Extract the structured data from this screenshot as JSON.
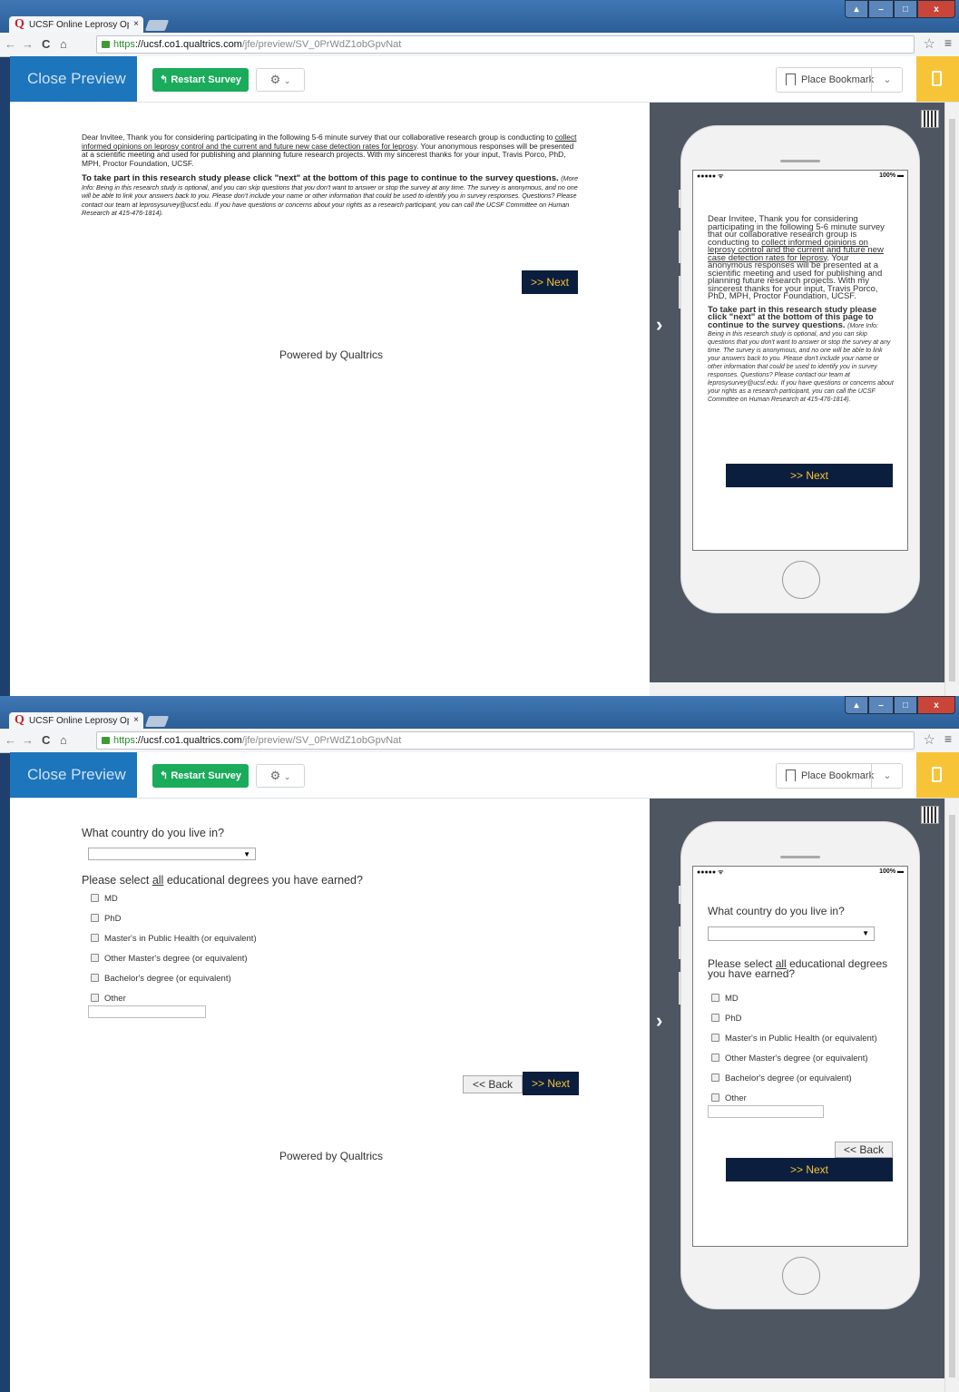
{
  "browser": {
    "tab_title": "UCSF Online Leprosy Opi",
    "tab_close": "×",
    "url_https": "https",
    "url_host": "://ucsf.co1.qualtrics.com",
    "url_path": "/jfe/preview/SV_0PrWdZ1obGpvNat"
  },
  "header": {
    "close_preview": "Close Preview",
    "restart_survey": "Restart Survey",
    "place_bookmark": "Place Bookmark"
  },
  "page1": {
    "intro_p1a": "Dear Invitee,  Thank you for considering participating in the following 5-6 minute survey that our collaborative research group is conducting to ",
    "intro_link": "collect informed opinions on leprosy control and the current and future new case detection rates for leprosy",
    "intro_p1b": ".  Your anonymous responses will be presented at a scientific meeting and used for publishing and planning future research projects.  With my sincerest thanks for your input, Travis Porco, PhD, MPH, Proctor Foundation, UCSF.",
    "intro_bold": "To take part in this research study please click \"next\" at the bottom of this page to continue to the survey questions",
    "intro_italic": "(More Info: Being in this research study is optional, and you can skip questions that you don't want to answer or stop the survey at any time.  The survey is anonymous, and no one will be able to link your answers back to you. Please don't include your name or other information that could be used to identify you in survey responses. Questions? Please contact our team  at leprosysurvey@ucsf.edu. If you have questions or concerns about your rights as a research participant, you can call the UCSF Committee on Human Research at 415-476-1814).",
    "next": ">> Next",
    "powered": "Powered by Qualtrics"
  },
  "page2": {
    "q1": "What country do you live in?",
    "q2_a": "Please select ",
    "q2_u": "all",
    "q2_b": " educational degrees you have earned?",
    "options": [
      "MD",
      "PhD",
      "Master's in Public Health (or equivalent)",
      "Other Master's degree (or equivalent)",
      "Bachelor's degree (or equivalent)",
      "Other"
    ],
    "back": "<< Back",
    "next": ">> Next",
    "powered": "Powered by Qualtrics"
  },
  "phone": {
    "signal": "●●●●● ᯤ",
    "battery": "100% ▬"
  }
}
